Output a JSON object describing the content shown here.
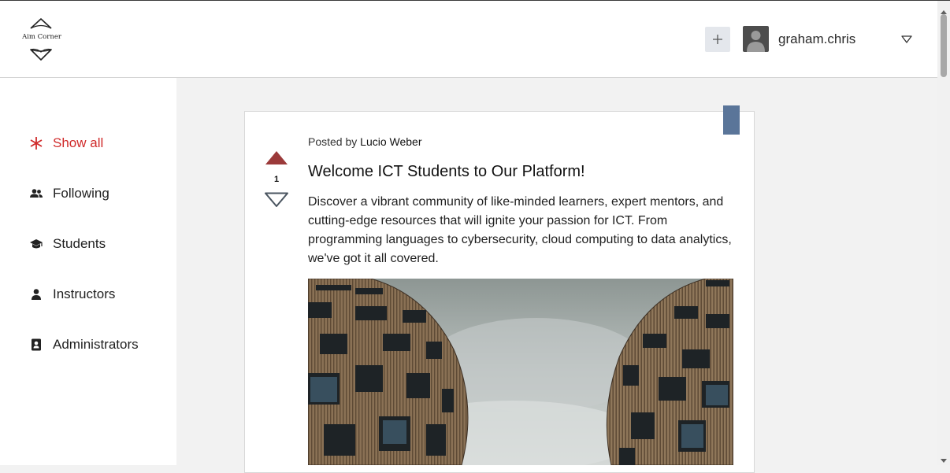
{
  "brand": {
    "logo_text": "Aim Corner"
  },
  "header": {
    "add_button_icon": "plus-icon",
    "user": {
      "name": "graham.chris",
      "avatar_icon": "user-avatar-icon",
      "menu_icon": "chevron-down-icon"
    }
  },
  "sidebar": {
    "items": [
      {
        "label": "Show all",
        "icon": "asterisk-icon",
        "active": true
      },
      {
        "label": "Following",
        "icon": "people-icon",
        "active": false
      },
      {
        "label": "Students",
        "icon": "graduation-cap-icon",
        "active": false
      },
      {
        "label": "Instructors",
        "icon": "person-icon",
        "active": false
      },
      {
        "label": "Administrators",
        "icon": "badge-icon",
        "active": false
      }
    ]
  },
  "post": {
    "posted_prefix": "Posted by",
    "author": "Lucio Weber",
    "vote_count": "1",
    "title": "Welcome ICT Students to Our Platform!",
    "body": "Discover a vibrant community of like-minded learners, expert mentors, and cutting-edge resources that will ignite your passion for ICT. From programming languages to cybersecurity, cloud computing to data analytics, we've got it all covered.",
    "image": "curved-buildings-photo"
  },
  "colors": {
    "accent": "#d02b2b",
    "upvote_active": "#9b3a3a",
    "bookmark": "#5a7599",
    "add_button_bg": "#e4e7ec"
  }
}
